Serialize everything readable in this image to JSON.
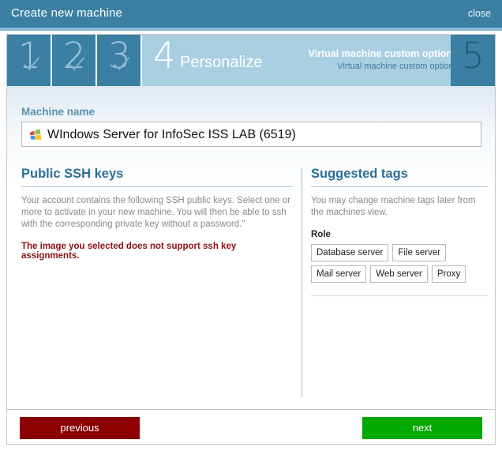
{
  "window": {
    "title": "Create new machine",
    "close_label": "close"
  },
  "steps": {
    "completed": [
      {
        "number": "1",
        "icon": "check-icon"
      },
      {
        "number": "2",
        "icon": "check-icon"
      },
      {
        "number": "3",
        "icon": "check-icon"
      }
    ],
    "active": {
      "number": "4",
      "label": "Personalize",
      "options_main": "Virtual machine custom options",
      "options_sub": "Virtual machine custom options"
    },
    "upcoming": {
      "number": "5"
    }
  },
  "machine_name": {
    "label": "Machine name",
    "value": "WIndows Server for InfoSec ISS LAB (6519)",
    "placeholder": "Machine name",
    "os_icon": "windows-logo-icon"
  },
  "ssh": {
    "heading": "Public SSH keys",
    "description": "Your account contains the following SSH public keys. Select one or more to activate in your new machine. You will then be able to ssh with the corresponding private key without a password.\"",
    "warning": "The image you selected does not support ssh key assignments."
  },
  "tags": {
    "heading": "Suggested tags",
    "description": "You may change machine tags later from the machines view.",
    "group_label": "Role",
    "rows": [
      [
        "Database server",
        "File server"
      ],
      [
        "Mail server",
        "Web server",
        "Proxy"
      ]
    ]
  },
  "footer": {
    "previous_label": "previous",
    "next_label": "next"
  },
  "colors": {
    "header_blue": "#3b7fa3",
    "active_step_blue": "#a9cfe2",
    "heading_blue": "#2a6f96",
    "warning_red": "#8c1212",
    "previous_red": "#8c0000",
    "next_green": "#00a800"
  }
}
